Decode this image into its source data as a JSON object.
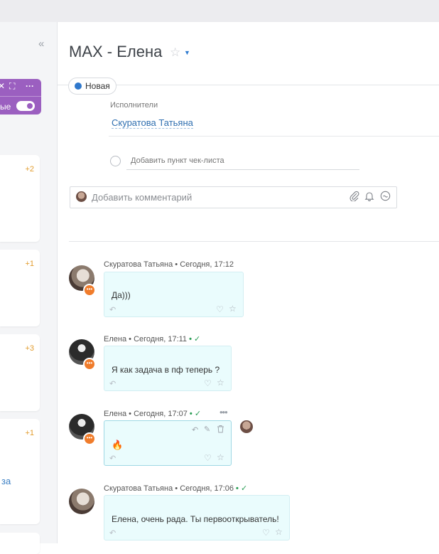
{
  "task": {
    "title": "MAX - Елена",
    "status": "Новая",
    "assignee_label": "Исполнители",
    "assignee": "Скуратова Татьяна",
    "checklist_placeholder": "Добавить пункт чек-листа"
  },
  "comment": {
    "placeholder": "Добавить комментарий"
  },
  "left_panel": {
    "toggle_text": "ые",
    "badges": [
      "+2",
      "+1",
      "+3",
      "+1"
    ],
    "link_text": "за"
  },
  "messages": [
    {
      "author": "Скуратова Татьяна",
      "time": "Сегодня, 17:12",
      "read": false,
      "text": "Да)))"
    },
    {
      "author": "Елена",
      "time": "Сегодня, 17:11",
      "read": true,
      "text": "Я как задача в пф теперь ?"
    },
    {
      "author": "Елена",
      "time": "Сегодня, 17:07",
      "read": true,
      "text": "🔥"
    },
    {
      "author": "Скуратова Татьяна",
      "time": "Сегодня, 17:06",
      "read": true,
      "text": "Елена, очень рада. Ты первооткрыватель!"
    }
  ],
  "colors": {
    "accent": "#2f78cc",
    "purple": "#9b5fc0",
    "bubble": "#eafcfd",
    "badge_orange": "#f07c2b",
    "read_check": "#2a9d55"
  }
}
